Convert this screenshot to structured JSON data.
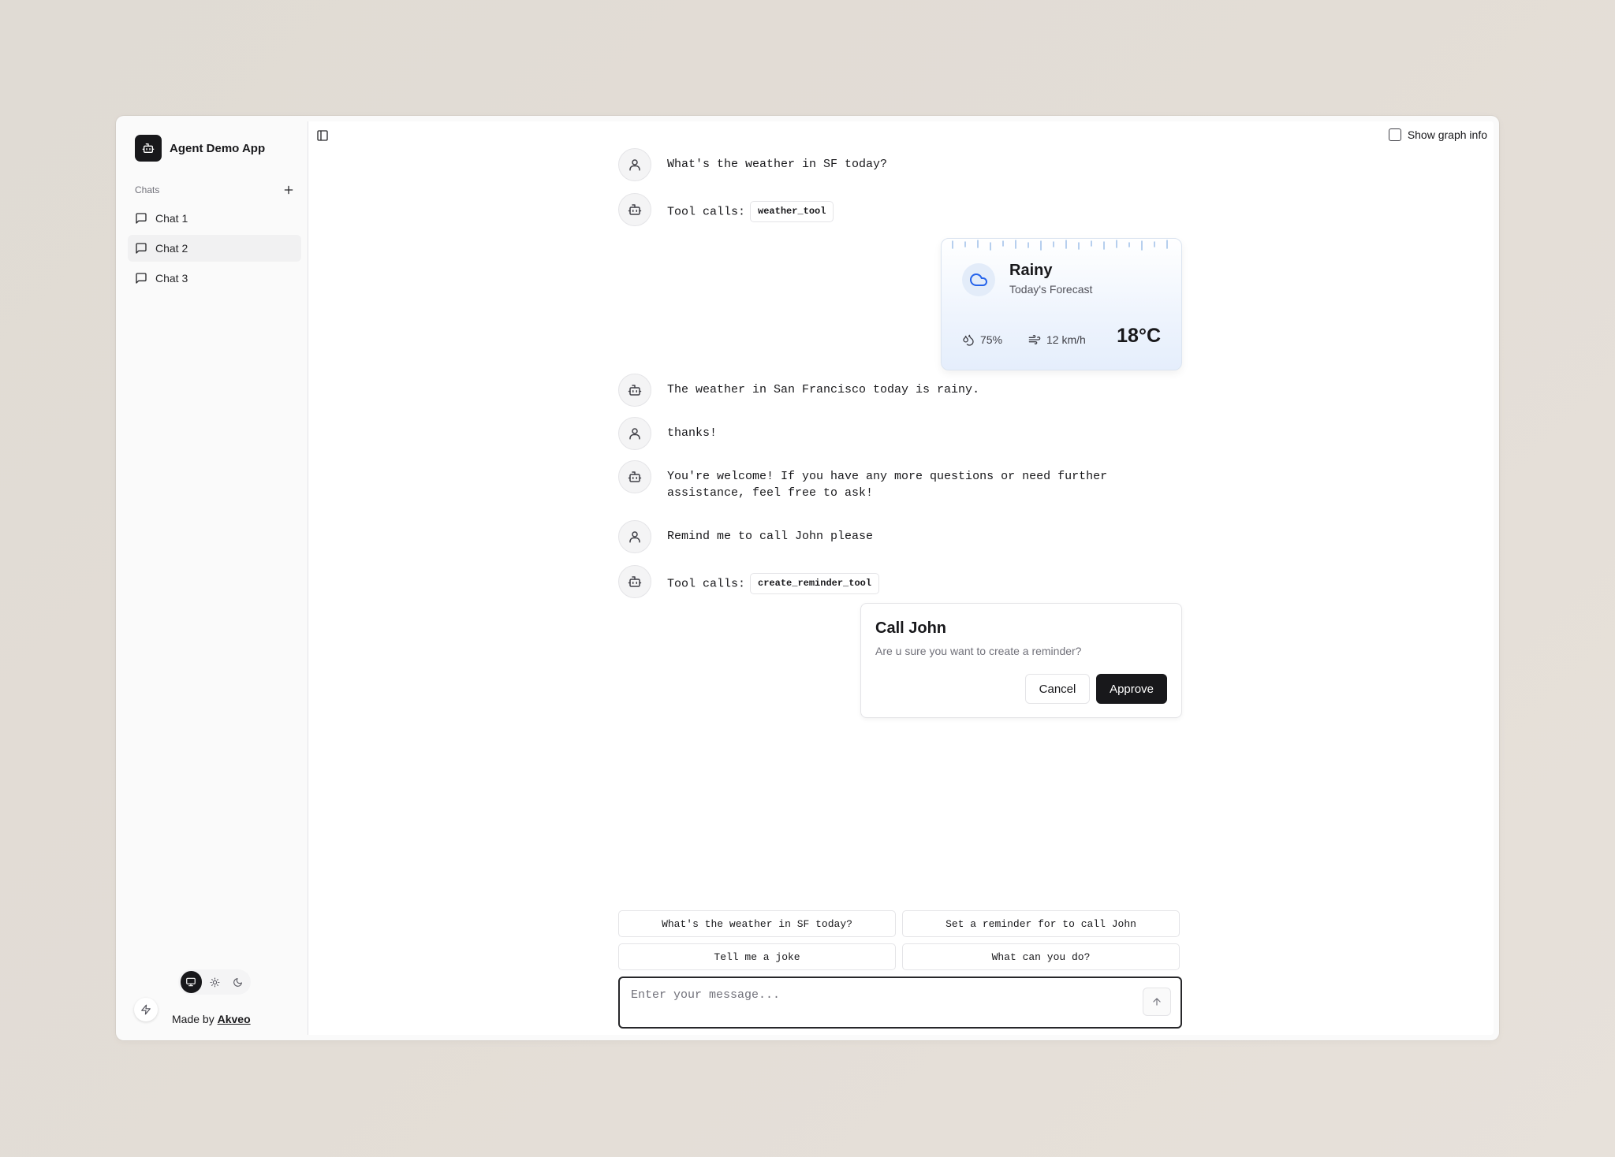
{
  "app": {
    "title": "Agent Demo App"
  },
  "sidebar": {
    "chats_label": "Chats",
    "items": [
      {
        "label": "Chat 1",
        "active": false
      },
      {
        "label": "Chat 2",
        "active": true
      },
      {
        "label": "Chat 3",
        "active": false
      }
    ],
    "made_by_prefix": "Made by",
    "made_by_link": "Akveo",
    "theme_selected": "system"
  },
  "header": {
    "graph_toggle_label": "Show graph info",
    "graph_toggle_checked": false
  },
  "messages": [
    {
      "role": "user",
      "text": "What's the weather in SF today?"
    },
    {
      "role": "assistant",
      "text": "Tool calls:",
      "tool": "weather_tool"
    },
    {
      "role": "assistant",
      "text": "The weather in San Francisco today is rainy."
    },
    {
      "role": "user",
      "text": "thanks!"
    },
    {
      "role": "assistant",
      "text": "You're welcome! If you have any more questions or need further\nassistance, feel free to ask!"
    },
    {
      "role": "user",
      "text": "Remind me to call John please"
    },
    {
      "role": "assistant",
      "text": "Tool calls:",
      "tool": "create_reminder_tool"
    }
  ],
  "weather": {
    "condition": "Rainy",
    "subtitle": "Today's Forecast",
    "humidity": "75%",
    "wind": "12 km/h",
    "temperature": "18°C",
    "accent": "#2563eb"
  },
  "reminder": {
    "title": "Call John",
    "description": "Are u sure you want to create a reminder?",
    "cancel_label": "Cancel",
    "approve_label": "Approve"
  },
  "suggestions": [
    "What's the weather in SF today?",
    "Set a reminder for to call John",
    "Tell me a joke",
    "What can you do?"
  ],
  "composer": {
    "placeholder": "Enter your message...",
    "value": ""
  }
}
